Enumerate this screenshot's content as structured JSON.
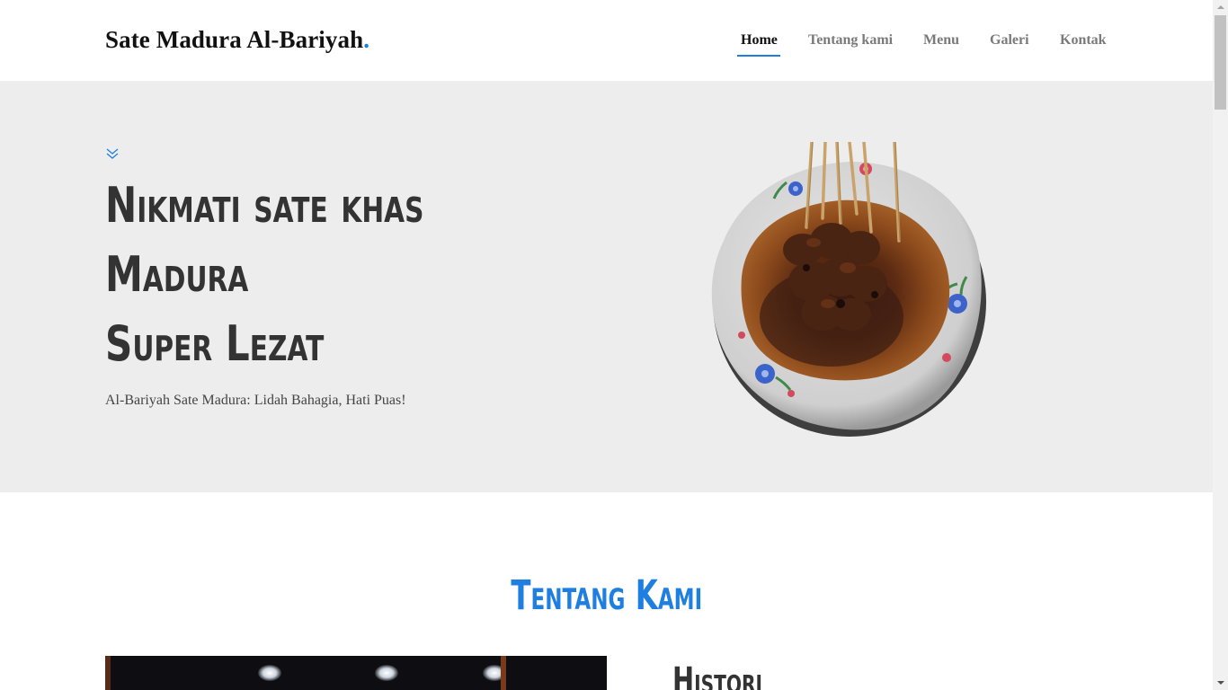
{
  "header": {
    "brand": "Sate Madura Al-Bariyah",
    "brand_dot": ".",
    "nav": [
      {
        "label": "Home",
        "active": true
      },
      {
        "label": "Tentang kami",
        "active": false
      },
      {
        "label": "Menu",
        "active": false
      },
      {
        "label": "Galeri",
        "active": false
      },
      {
        "label": "Kontak",
        "active": false
      }
    ]
  },
  "hero": {
    "icon": "double-chevron-down-icon",
    "title_lines": [
      "Nikmati sate khas",
      "Madura",
      "Super Lezat"
    ],
    "subtitle": "Al-Bariyah Sate Madura: Lidah Bahagia, Hati Puas!",
    "image": "sate-plate-image",
    "background": "#ededed"
  },
  "about": {
    "title": "Tentang Kami",
    "subheading": "Histori"
  },
  "colors": {
    "accent": "#1e7fe0",
    "text_dark": "#111111",
    "nav_inactive": "#7a7a7a"
  }
}
